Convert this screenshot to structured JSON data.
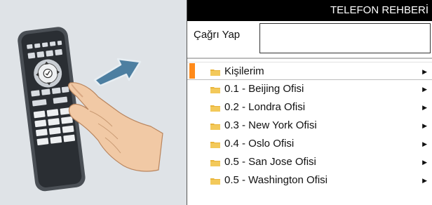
{
  "phonebook": {
    "title": "TELEFON REHBERİ",
    "call_label": "Çağrı Yap",
    "call_value": "",
    "items": [
      {
        "label": "Kişilerim",
        "selected": true
      },
      {
        "label": "0.1 - Beijing Ofisi",
        "selected": false
      },
      {
        "label": "0.2 - Londra Ofisi",
        "selected": false
      },
      {
        "label": "0.3 - New York Ofisi",
        "selected": false
      },
      {
        "label": "0.4 - Oslo Ofisi",
        "selected": false
      },
      {
        "label": "0.5 - San Jose Ofisi",
        "selected": false
      },
      {
        "label": "0.5 - Washington Ofisi",
        "selected": false
      }
    ],
    "chevron_icon": "triangle-right-icon",
    "folder_icon": "folder-icon"
  },
  "colors": {
    "header_bg": "#000000",
    "selection_accent": "#ff8a1a",
    "folder": "#e9b43a",
    "arrow": "#4d7fa1",
    "illustration_bg": "#dfe3e7"
  }
}
